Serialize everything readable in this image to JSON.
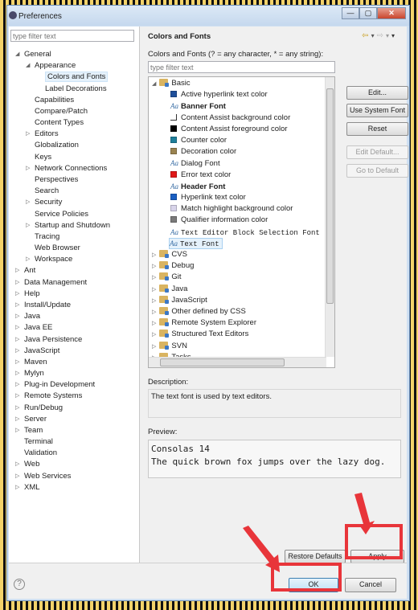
{
  "window": {
    "title": "Preferences",
    "controls": [
      "—",
      "▢",
      "✕"
    ]
  },
  "left": {
    "filter_placeholder": "type filter text",
    "items": [
      {
        "label": "General",
        "level": 0,
        "exp": "open"
      },
      {
        "label": "Appearance",
        "level": 1,
        "exp": "open"
      },
      {
        "label": "Colors and Fonts",
        "level": 2,
        "exp": "",
        "selected": true
      },
      {
        "label": "Label Decorations",
        "level": 2,
        "exp": ""
      },
      {
        "label": "Capabilities",
        "level": 1,
        "exp": ""
      },
      {
        "label": "Compare/Patch",
        "level": 1,
        "exp": ""
      },
      {
        "label": "Content Types",
        "level": 1,
        "exp": ""
      },
      {
        "label": "Editors",
        "level": 1,
        "exp": "closed"
      },
      {
        "label": "Globalization",
        "level": 1,
        "exp": ""
      },
      {
        "label": "Keys",
        "level": 1,
        "exp": ""
      },
      {
        "label": "Network Connections",
        "level": 1,
        "exp": "closed"
      },
      {
        "label": "Perspectives",
        "level": 1,
        "exp": ""
      },
      {
        "label": "Search",
        "level": 1,
        "exp": ""
      },
      {
        "label": "Security",
        "level": 1,
        "exp": "closed"
      },
      {
        "label": "Service Policies",
        "level": 1,
        "exp": ""
      },
      {
        "label": "Startup and Shutdown",
        "level": 1,
        "exp": "closed"
      },
      {
        "label": "Tracing",
        "level": 1,
        "exp": ""
      },
      {
        "label": "Web Browser",
        "level": 1,
        "exp": ""
      },
      {
        "label": "Workspace",
        "level": 1,
        "exp": "closed"
      },
      {
        "label": "Ant",
        "level": 0,
        "exp": "closed"
      },
      {
        "label": "Data Management",
        "level": 0,
        "exp": "closed"
      },
      {
        "label": "Help",
        "level": 0,
        "exp": "closed"
      },
      {
        "label": "Install/Update",
        "level": 0,
        "exp": "closed"
      },
      {
        "label": "Java",
        "level": 0,
        "exp": "closed"
      },
      {
        "label": "Java EE",
        "level": 0,
        "exp": "closed"
      },
      {
        "label": "Java Persistence",
        "level": 0,
        "exp": "closed"
      },
      {
        "label": "JavaScript",
        "level": 0,
        "exp": "closed"
      },
      {
        "label": "Maven",
        "level": 0,
        "exp": "closed"
      },
      {
        "label": "Mylyn",
        "level": 0,
        "exp": "closed"
      },
      {
        "label": "Plug-in Development",
        "level": 0,
        "exp": "closed"
      },
      {
        "label": "Remote Systems",
        "level": 0,
        "exp": "closed"
      },
      {
        "label": "Run/Debug",
        "level": 0,
        "exp": "closed"
      },
      {
        "label": "Server",
        "level": 0,
        "exp": "closed"
      },
      {
        "label": "Team",
        "level": 0,
        "exp": "closed"
      },
      {
        "label": "Terminal",
        "level": 0,
        "exp": ""
      },
      {
        "label": "Validation",
        "level": 0,
        "exp": ""
      },
      {
        "label": "Web",
        "level": 0,
        "exp": "closed"
      },
      {
        "label": "Web Services",
        "level": 0,
        "exp": "closed"
      },
      {
        "label": "XML",
        "level": 0,
        "exp": "closed"
      }
    ]
  },
  "right": {
    "title": "Colors and Fonts",
    "nav": [
      "⇦",
      "▾",
      "⇨",
      "▾",
      "▾"
    ],
    "filter_label": "Colors and Fonts (? = any character, * = any string):",
    "filter_placeholder": "type filter text",
    "basic": {
      "label": "Basic",
      "items": [
        {
          "label": "Active hyperlink text color",
          "kind": "color",
          "color": "#1f4f9a"
        },
        {
          "label": "Banner Font",
          "kind": "font",
          "bold": true
        },
        {
          "label": "Content Assist background color",
          "kind": "color",
          "color": "#ffffff"
        },
        {
          "label": "Content Assist foreground color",
          "kind": "color",
          "color": "#000000"
        },
        {
          "label": "Counter color",
          "kind": "color",
          "color": "#1f7f9a"
        },
        {
          "label": "Decoration color",
          "kind": "color",
          "color": "#9a8350"
        },
        {
          "label": "Dialog Font",
          "kind": "font"
        },
        {
          "label": "Error text color",
          "kind": "color",
          "color": "#e01818"
        },
        {
          "label": "Header Font",
          "kind": "font",
          "bold": true
        },
        {
          "label": "Hyperlink text color",
          "kind": "color",
          "color": "#1a5fc2"
        },
        {
          "label": "Match highlight background color",
          "kind": "color",
          "color": "#d8d4ea"
        },
        {
          "label": "Qualifier information color",
          "kind": "color",
          "color": "#7a7a7a"
        },
        {
          "label": "Text Editor Block Selection Font",
          "kind": "font",
          "mono": true
        },
        {
          "label": "Text Font",
          "kind": "font",
          "mono": true,
          "selected": true
        }
      ]
    },
    "categories": [
      "CVS",
      "Debug",
      "Git",
      "Java",
      "JavaScript",
      "Other defined by CSS",
      "Remote System Explorer",
      "Structured Text Editors",
      "SVN",
      "Tasks"
    ],
    "buttons": {
      "edit": "Edit...",
      "use_system_font": "Use System Font",
      "reset": "Reset",
      "edit_default": "Edit Default...",
      "go_to_default": "Go to Default"
    },
    "description_label": "Description:",
    "description": "The text font is used by text editors.",
    "preview_label": "Preview:",
    "preview_line1": "Consolas 14",
    "preview_line2": "The quick brown fox jumps over the lazy dog.",
    "restore_defaults": "Restore Defaults",
    "apply": "Apply"
  },
  "footer": {
    "ok": "OK",
    "cancel": "Cancel",
    "help": "?"
  },
  "annotation_color": "#e8353a"
}
